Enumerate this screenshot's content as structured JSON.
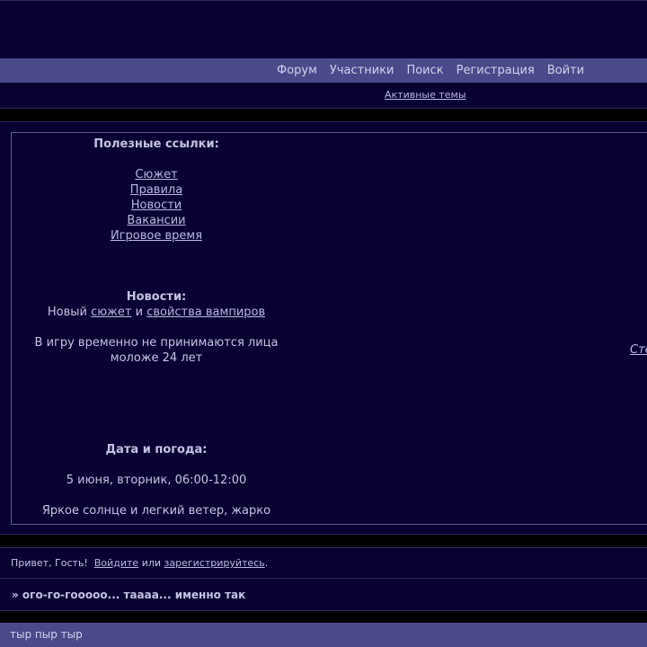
{
  "nav": {
    "items": [
      "Форум",
      "Участники",
      "Поиск",
      "Регистрация",
      "Войти"
    ],
    "sub_link": "Активные темы"
  },
  "sidebar": {
    "links_title": "Полезные ссылки:",
    "links": [
      "Сюжет",
      "Правила",
      "Новости",
      "Вакансии",
      "Игровое время"
    ],
    "news_title": "Новости:",
    "news_prefix": "Новый ",
    "news_link1": "сюжет",
    "news_mid": " и ",
    "news_link2": "свойства вампиров",
    "notice_line1": "В игру временно не принимаются лица",
    "notice_line2": "моложе 24 лет",
    "weather_title": "Дата и погода:",
    "date_text": "5 июня, вторник, 06:00-12:00",
    "weather_text": "Яркое солнце и легкий ветер, жарко"
  },
  "right_link": "Стеф",
  "greeting": {
    "text": "Привет, Гость!",
    "login_link": "Войдите",
    "or": " или ",
    "register_link": "зарегистрируйтесь",
    "period": ".",
    "announcement": "» ого-го-гооооо... тaaaa... именно так"
  },
  "footer": {
    "text": "тыр пыр тыр"
  },
  "colors": {
    "background": "#000000",
    "panel": "#080030",
    "navbar": "#4a4a8a",
    "text": "#c4c4e6"
  }
}
